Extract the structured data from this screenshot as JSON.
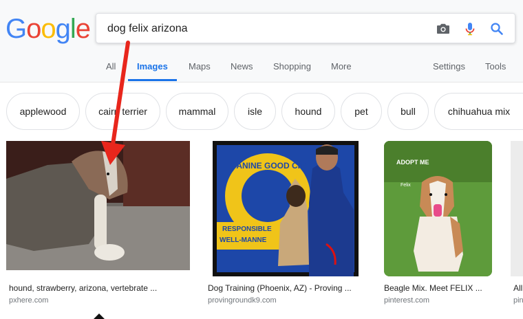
{
  "logo": {
    "letters": [
      "G",
      "o",
      "o",
      "g",
      "l",
      "e"
    ],
    "colors": [
      "#4285F4",
      "#EA4335",
      "#FBBC05",
      "#4285F4",
      "#34A853",
      "#EA4335"
    ]
  },
  "search": {
    "query": "dog felix arizona"
  },
  "icons": {
    "camera": "camera-icon",
    "mic": "microphone-icon",
    "search": "magnifier-icon"
  },
  "tabs": [
    {
      "label": "All"
    },
    {
      "label": "Images"
    },
    {
      "label": "Maps"
    },
    {
      "label": "News"
    },
    {
      "label": "Shopping"
    },
    {
      "label": "More"
    },
    {
      "label": "Settings"
    },
    {
      "label": "Tools"
    }
  ],
  "chips": [
    {
      "label": "applewood"
    },
    {
      "label": "cairn terrier"
    },
    {
      "label": "mammal"
    },
    {
      "label": "isle"
    },
    {
      "label": "hound"
    },
    {
      "label": "pet"
    },
    {
      "label": "bull"
    },
    {
      "label": "chihuahua mix"
    }
  ],
  "results": [
    {
      "caption": "hound, strawberry, arizona, vertebrate ...",
      "source": "pxhere.com"
    },
    {
      "caption": "Dog Training (Phoenix, AZ) - Proving ...",
      "source": "provingroundk9.com"
    },
    {
      "caption": "Beagle Mix. Meet FELIX ...",
      "source": "pinterest.com"
    },
    {
      "caption": "All",
      "source": "pin"
    }
  ],
  "image_text": {
    "canine_good_citizen": "CANINE GOOD CIT",
    "responsible": "RESPONSIBLE",
    "well_mannered": "WELL-MANNE",
    "adopt_me": "ADOPT ME",
    "felix": "Felix"
  },
  "annotation": {
    "color": "#e8261c"
  }
}
